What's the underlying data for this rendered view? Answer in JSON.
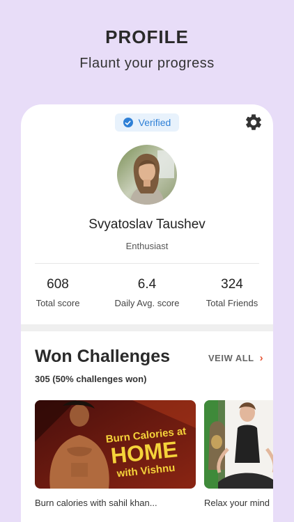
{
  "header": {
    "title": "PROFILE",
    "subtitle": "Flaunt your progress"
  },
  "profile": {
    "verified_label": "Verified",
    "name": "Svyatoslav Taushev",
    "role": "Enthusiast"
  },
  "stats": [
    {
      "value": "608",
      "label": "Total score"
    },
    {
      "value": "6.4",
      "label": "Daily Avg. score"
    },
    {
      "value": "324",
      "label": "Total Friends"
    }
  ],
  "challenges": {
    "title": "Won Challenges",
    "view_all": "VEIW ALL",
    "summary": "305 (50% challenges won)",
    "cards": [
      {
        "caption": "Burn calories with sahil khan...",
        "banner_line1": "Burn Calories at",
        "banner_line2": "HOME",
        "banner_line3": "with Vishnu"
      },
      {
        "caption": "Relax your mind"
      }
    ]
  },
  "colors": {
    "background": "#e8ddf8",
    "accent_blue": "#2f80d6",
    "chevron": "#e65232",
    "banner_text": "#f5d33a"
  },
  "icons": [
    "check-icon",
    "gear-icon",
    "chevron-right-icon"
  ]
}
